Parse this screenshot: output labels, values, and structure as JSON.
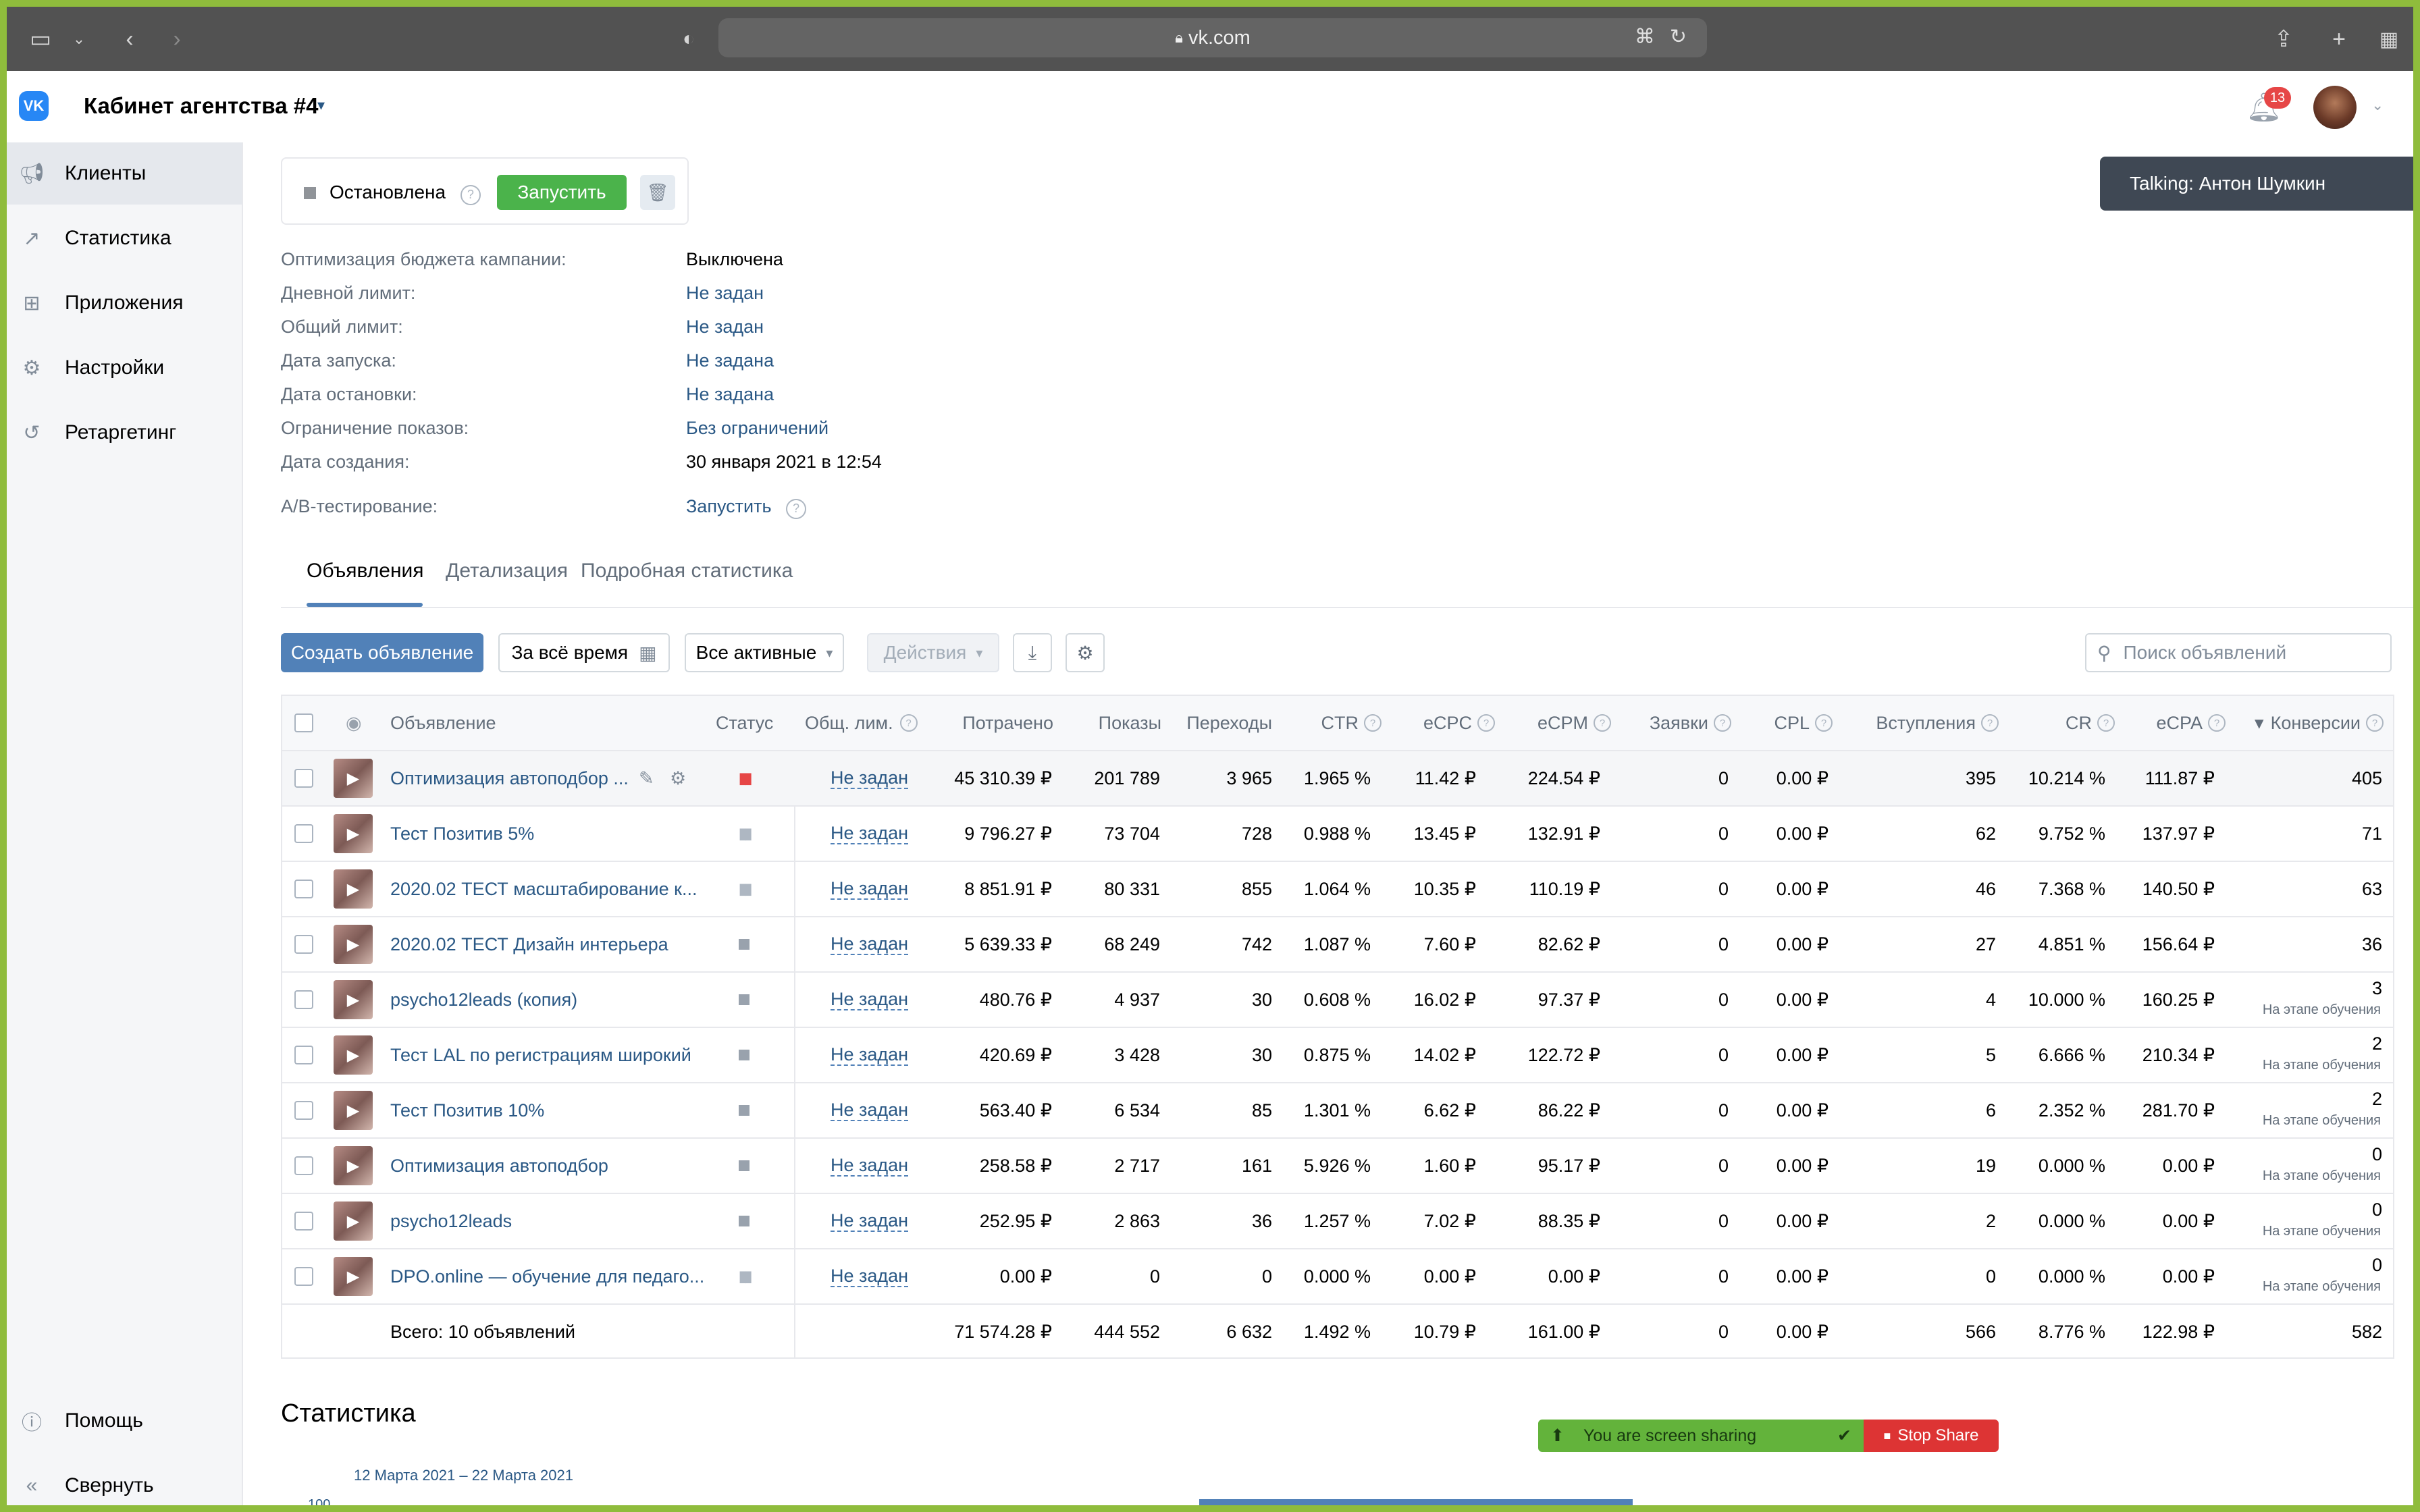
{
  "browser": {
    "url": "vk.com"
  },
  "header": {
    "title": "Кабинет агентства #4",
    "notifications": "13"
  },
  "sidebar": {
    "items": [
      {
        "label": "Клиенты",
        "icon": "megaphone-icon"
      },
      {
        "label": "Статистика",
        "icon": "chart-line-icon"
      },
      {
        "label": "Приложения",
        "icon": "apps-grid-icon"
      },
      {
        "label": "Настройки",
        "icon": "gear-icon"
      },
      {
        "label": "Ретаргетинг",
        "icon": "retarget-icon"
      }
    ],
    "help": "Помощь",
    "collapse": "Свернуть"
  },
  "campaign": {
    "status": "Остановлена",
    "start_button": "Запустить",
    "props": [
      {
        "label": "Оптимизация бюджета кампании:",
        "value": "Выключена",
        "link": false
      },
      {
        "label": "Дневной лимит:",
        "value": "Не задан",
        "link": true
      },
      {
        "label": "Общий лимит:",
        "value": "Не задан",
        "link": true
      },
      {
        "label": "Дата запуска:",
        "value": "Не задана",
        "link": true
      },
      {
        "label": "Дата остановки:",
        "value": "Не задана",
        "link": true
      },
      {
        "label": "Ограничение показов:",
        "value": "Без ограничений",
        "link": true
      },
      {
        "label": "Дата создания:",
        "value": "30 января 2021 в 12:54",
        "link": false
      }
    ],
    "ab_label": "A/B-тестирование:",
    "ab_value": "Запустить"
  },
  "tabs": [
    "Объявления",
    "Детализация",
    "Подробная статистика"
  ],
  "toolbar": {
    "create": "Создать объявление",
    "period": "За всё время",
    "filter": "Все активные",
    "actions": "Действия",
    "search_placeholder": "Поиск объявлений"
  },
  "table": {
    "headers": [
      "Объявление",
      "Статус",
      "Общ. лим.",
      "Потрачено",
      "Показы",
      "Переходы",
      "CTR",
      "eCPC",
      "eCPM",
      "Заявки",
      "CPL",
      "Вступления",
      "CR",
      "eCPA",
      "Конверсии"
    ],
    "rows": [
      {
        "name": "Оптимизация автоподбор ...",
        "status": "pause-red",
        "limit": "Не задан",
        "spent": "45 310.39 ₽",
        "shows": "201 789",
        "clicks": "3 965",
        "ctr": "1.965 %",
        "ecpc": "11.42 ₽",
        "ecpm": "224.54 ₽",
        "leads": "0",
        "cpl": "0.00 ₽",
        "joins": "395",
        "cr": "10.214 %",
        "ecpa": "111.87 ₽",
        "conv": "405",
        "note": ""
      },
      {
        "name": "Тест Позитив 5%",
        "status": "pause",
        "limit": "Не задан",
        "spent": "9 796.27 ₽",
        "shows": "73 704",
        "clicks": "728",
        "ctr": "0.988 %",
        "ecpc": "13.45 ₽",
        "ecpm": "132.91 ₽",
        "leads": "0",
        "cpl": "0.00 ₽",
        "joins": "62",
        "cr": "9.752 %",
        "ecpa": "137.97 ₽",
        "conv": "71",
        "note": ""
      },
      {
        "name": "2020.02 ТЕСТ масштабирование к...",
        "status": "pause",
        "limit": "Не задан",
        "spent": "8 851.91 ₽",
        "shows": "80 331",
        "clicks": "855",
        "ctr": "1.064 %",
        "ecpc": "10.35 ₽",
        "ecpm": "110.19 ₽",
        "leads": "0",
        "cpl": "0.00 ₽",
        "joins": "46",
        "cr": "7.368 %",
        "ecpa": "140.50 ₽",
        "conv": "63",
        "note": ""
      },
      {
        "name": "2020.02 ТЕСТ Дизайн интерьера",
        "status": "stop",
        "limit": "Не задан",
        "spent": "5 639.33 ₽",
        "shows": "68 249",
        "clicks": "742",
        "ctr": "1.087 %",
        "ecpc": "7.60 ₽",
        "ecpm": "82.62 ₽",
        "leads": "0",
        "cpl": "0.00 ₽",
        "joins": "27",
        "cr": "4.851 %",
        "ecpa": "156.64 ₽",
        "conv": "36",
        "note": ""
      },
      {
        "name": "psycho12leads (копия)",
        "status": "stop",
        "limit": "Не задан",
        "spent": "480.76 ₽",
        "shows": "4 937",
        "clicks": "30",
        "ctr": "0.608 %",
        "ecpc": "16.02 ₽",
        "ecpm": "97.37 ₽",
        "leads": "0",
        "cpl": "0.00 ₽",
        "joins": "4",
        "cr": "10.000 %",
        "ecpa": "160.25 ₽",
        "conv": "3",
        "note": "На этапе обучения"
      },
      {
        "name": "Тест LAL по регистрациям широкий",
        "status": "stop",
        "limit": "Не задан",
        "spent": "420.69 ₽",
        "shows": "3 428",
        "clicks": "30",
        "ctr": "0.875 %",
        "ecpc": "14.02 ₽",
        "ecpm": "122.72 ₽",
        "leads": "0",
        "cpl": "0.00 ₽",
        "joins": "5",
        "cr": "6.666 %",
        "ecpa": "210.34 ₽",
        "conv": "2",
        "note": "На этапе обучения"
      },
      {
        "name": "Тест Позитив 10%",
        "status": "stop",
        "limit": "Не задан",
        "spent": "563.40 ₽",
        "shows": "6 534",
        "clicks": "85",
        "ctr": "1.301 %",
        "ecpc": "6.62 ₽",
        "ecpm": "86.22 ₽",
        "leads": "0",
        "cpl": "0.00 ₽",
        "joins": "6",
        "cr": "2.352 %",
        "ecpa": "281.70 ₽",
        "conv": "2",
        "note": "На этапе обучения"
      },
      {
        "name": "Оптимизация автоподбор",
        "status": "stop",
        "limit": "Не задан",
        "spent": "258.58 ₽",
        "shows": "2 717",
        "clicks": "161",
        "ctr": "5.926 %",
        "ecpc": "1.60 ₽",
        "ecpm": "95.17 ₽",
        "leads": "0",
        "cpl": "0.00 ₽",
        "joins": "19",
        "cr": "0.000 %",
        "ecpa": "0.00 ₽",
        "conv": "0",
        "note": "На этапе обучения"
      },
      {
        "name": "psycho12leads",
        "status": "stop",
        "limit": "Не задан",
        "spent": "252.95 ₽",
        "shows": "2 863",
        "clicks": "36",
        "ctr": "1.257 %",
        "ecpc": "7.02 ₽",
        "ecpm": "88.35 ₽",
        "leads": "0",
        "cpl": "0.00 ₽",
        "joins": "2",
        "cr": "0.000 %",
        "ecpa": "0.00 ₽",
        "conv": "0",
        "note": "На этапе обучения"
      },
      {
        "name": "DPO.online — обучение для педаго...",
        "status": "pause",
        "limit": "Не задан",
        "spent": "0.00 ₽",
        "shows": "0",
        "clicks": "0",
        "ctr": "0.000 %",
        "ecpc": "0.00 ₽",
        "ecpm": "0.00 ₽",
        "leads": "0",
        "cpl": "0.00 ₽",
        "joins": "0",
        "cr": "0.000 %",
        "ecpa": "0.00 ₽",
        "conv": "0",
        "note": "На этапе обучения"
      }
    ],
    "total": {
      "name": "Всего: 10 объявлений",
      "spent": "71 574.28 ₽",
      "shows": "444 552",
      "clicks": "6 632",
      "ctr": "1.492 %",
      "ecpc": "10.79 ₽",
      "ecpm": "161.00 ₽",
      "leads": "0",
      "cpl": "0.00 ₽",
      "joins": "566",
      "cr": "8.776 %",
      "ecpa": "122.98 ₽",
      "conv": "582"
    }
  },
  "stats": {
    "title": "Статистика",
    "range": "12 Марта 2021 – 22 Марта 2021",
    "axis_top": "100"
  },
  "overlays": {
    "talking": "Talking: Антон Шумкин",
    "sharing": "You are screen sharing",
    "stop_share": "Stop Share"
  }
}
